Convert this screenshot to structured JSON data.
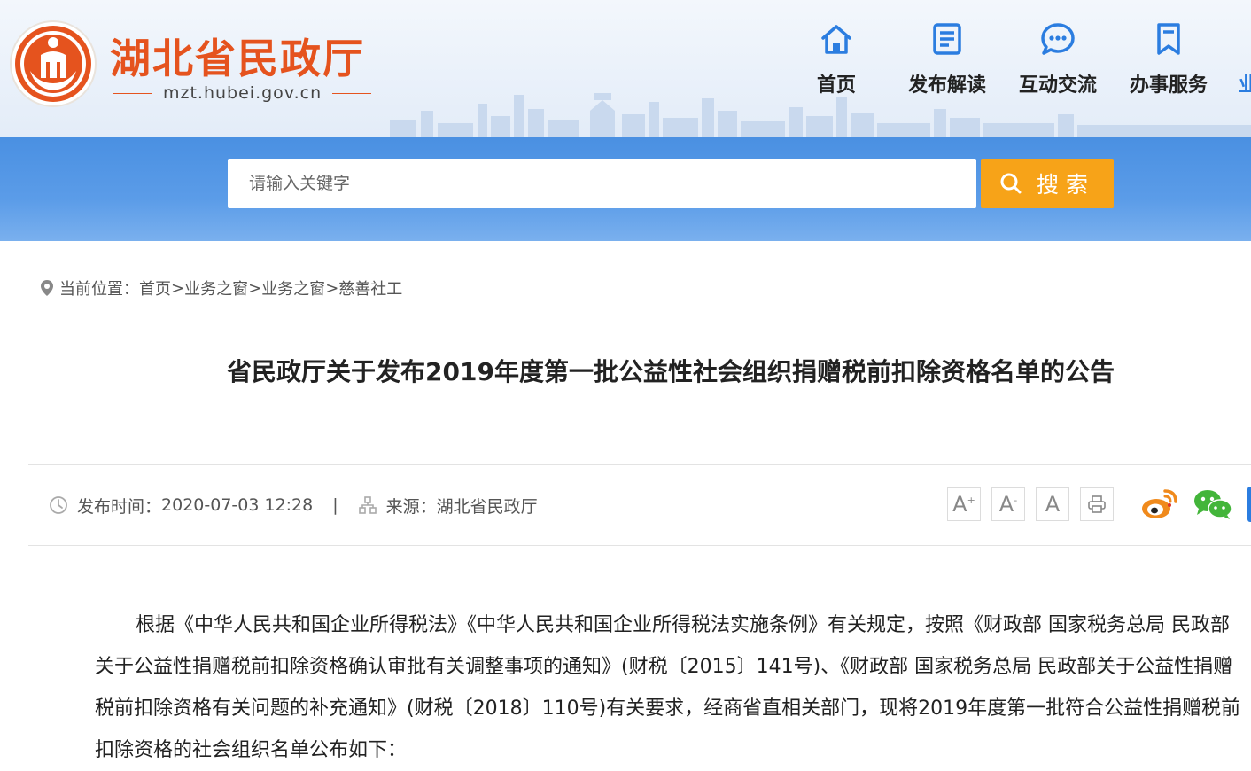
{
  "header": {
    "site_name": "湖北省民政厅",
    "site_url": "mzt.hubei.gov.cn",
    "nav": [
      {
        "label": "首页",
        "icon": "home-icon"
      },
      {
        "label": "发布解读",
        "icon": "document-icon"
      },
      {
        "label": "互动交流",
        "icon": "chat-icon"
      },
      {
        "label": "办事服务",
        "icon": "bookmark-icon"
      },
      {
        "label": "业"
      }
    ]
  },
  "search": {
    "placeholder": "请输入关键字",
    "button_label": "搜索"
  },
  "breadcrumb": {
    "prefix": "当前位置：",
    "items": [
      "首页",
      "业务之窗",
      "业务之窗",
      "慈善社工"
    ],
    "separator": ">"
  },
  "article": {
    "title": "省民政厅关于发布2019年度第一批公益性社会组织捐赠税前扣除资格名单的公告",
    "publish_label": "发布时间：",
    "publish_time": "2020-07-03 12:28",
    "divider": "|",
    "source_label": "来源：",
    "source": "湖北省民政厅",
    "body": "根据《中华人民共和国企业所得税法》《中华人民共和国企业所得税法实施条例》有关规定，按照《财政部 国家税务总局 民政部关于公益性捐赠税前扣除资格确认审批有关调整事项的通知》(财税〔2015〕141号)、《财政部 国家税务总局 民政部关于公益性捐赠税前扣除资格有关问题的补充通知》(财税〔2018〕110号)有关要求，经商省直相关部门，现将2019年度第一批符合公益性捐赠税前扣除资格的社会组织名单公布如下："
  },
  "tools": {
    "font_increase": "A",
    "font_decrease": "A",
    "font_reset": "A",
    "plus_mark": "+",
    "minus_mark": "-"
  },
  "colors": {
    "brand_orange": "#e5531e",
    "search_band": "#4a90e2",
    "search_button": "#f7a318",
    "nav_icon_blue": "#2b7de0",
    "weibo_orange": "#f08a1c",
    "wechat_green": "#43b53a"
  }
}
